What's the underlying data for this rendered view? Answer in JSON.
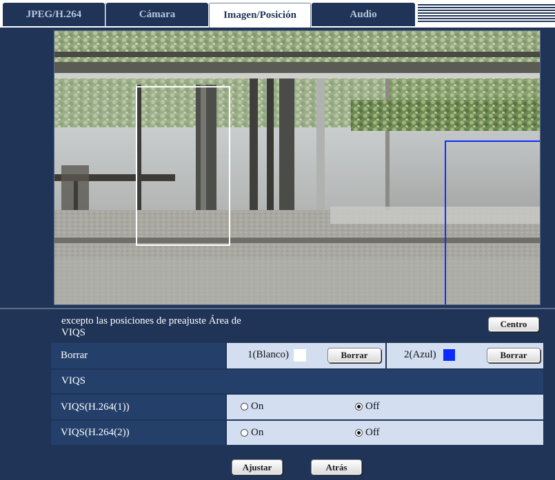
{
  "tabs": [
    {
      "label": "JPEG/H.264",
      "active": false
    },
    {
      "label": "Cámara",
      "active": false
    },
    {
      "label": "Imagen/Posición",
      "active": true
    },
    {
      "label": "Audio",
      "active": false
    }
  ],
  "viqs_area": {
    "title_line1": "excepto las posiciones de preajuste  Área de",
    "title_line2": "VIQS",
    "center_button": "Centro"
  },
  "borrar_row": {
    "label": "Borrar",
    "area1_label": "1(Blanco)",
    "area1_color": "#ffffff",
    "area1_button": "Borrar",
    "area2_label": "2(Azul)",
    "area2_color": "#0b2bff",
    "area2_button": "Borrar"
  },
  "viqs_header": "VIQS",
  "viqs_rows": [
    {
      "label": "VIQS(H.264(1))",
      "on_label": "On",
      "off_label": "Off",
      "selected": "Off"
    },
    {
      "label": "VIQS(H.264(2))",
      "on_label": "On",
      "off_label": "Off",
      "selected": "Off"
    }
  ],
  "footer": {
    "set_button": "Ajustar",
    "back_button": "Atrás"
  },
  "colors": {
    "panel_bg": "#1f3457",
    "row_bg": "#d3def1",
    "area_white": "#ffffff",
    "area_blue": "#0b2bff"
  }
}
